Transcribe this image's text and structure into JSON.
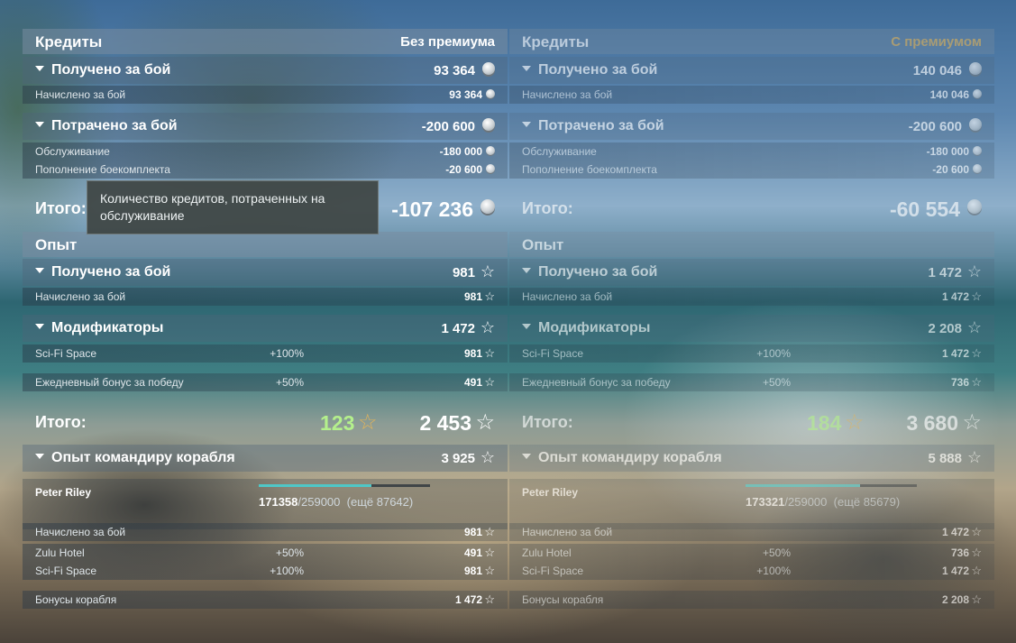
{
  "left": {
    "credits": {
      "header_title": "Кредиты",
      "header_right": "Без премиума",
      "earned": {
        "title": "Получено за бой",
        "value": "93 364",
        "items": [
          {
            "label": "Начислено за бой",
            "value": "93 364"
          }
        ]
      },
      "spent": {
        "title": "Потрачено за бой",
        "value": "-200 600",
        "items": [
          {
            "label": "Обслуживание",
            "value": "-180 000"
          },
          {
            "label": "Пополнение боекомплекта",
            "value": "-20 600"
          }
        ]
      },
      "total_label": "Итого:",
      "total_value": "-107 236"
    },
    "experience": {
      "header_title": "Опыт",
      "earned": {
        "title": "Получено за бой",
        "value": "981",
        "items": [
          {
            "label": "Начислено за бой",
            "value": "981"
          }
        ]
      },
      "modifiers": {
        "title": "Модификаторы",
        "value": "1 472",
        "items": [
          {
            "label": "Sci-Fi Space",
            "pct": "+100%",
            "value": "981"
          },
          {
            "label": "Ежедневный бонус за победу",
            "pct": "+50%",
            "value": "491"
          }
        ]
      },
      "total_label": "Итого:",
      "total_free": "123",
      "total_value": "2 453",
      "commander": {
        "title": "Опыт командиру корабля",
        "value": "3 925",
        "name": "Peter Riley",
        "progress_current": "171358",
        "progress_sep": "/",
        "progress_max": "259000",
        "progress_remaining": "(ещё 87642)",
        "progress_fraction": 0.66,
        "items": [
          {
            "label": "Начислено за бой",
            "pct": "",
            "value": "981"
          },
          {
            "label": "Zulu Hotel",
            "pct": "+50%",
            "value": "491"
          },
          {
            "label": "Sci-Fi Space",
            "pct": "+100%",
            "value": "981"
          },
          {
            "label": "Бонусы корабля",
            "pct": "",
            "value": "1 472"
          }
        ]
      }
    }
  },
  "right": {
    "credits": {
      "header_title": "Кредиты",
      "header_right": "С премиумом",
      "earned": {
        "title": "Получено за бой",
        "value": "140 046",
        "items": [
          {
            "label": "Начислено за бой",
            "value": "140 046"
          }
        ]
      },
      "spent": {
        "title": "Потрачено за бой",
        "value": "-200 600",
        "items": [
          {
            "label": "Обслуживание",
            "value": "-180 000"
          },
          {
            "label": "Пополнение боекомплекта",
            "value": "-20 600"
          }
        ]
      },
      "total_label": "Итого:",
      "total_value": "-60 554"
    },
    "experience": {
      "header_title": "Опыт",
      "earned": {
        "title": "Получено за бой",
        "value": "1 472",
        "items": [
          {
            "label": "Начислено за бой",
            "value": "1 472"
          }
        ]
      },
      "modifiers": {
        "title": "Модификаторы",
        "value": "2 208",
        "items": [
          {
            "label": "Sci-Fi Space",
            "pct": "+100%",
            "value": "1 472"
          },
          {
            "label": "Ежедневный бонус за победу",
            "pct": "+50%",
            "value": "736"
          }
        ]
      },
      "total_label": "Итого:",
      "total_free": "184",
      "total_value": "3 680",
      "commander": {
        "title": "Опыт командиру корабля",
        "value": "5 888",
        "name": "Peter Riley",
        "progress_current": "173321",
        "progress_sep": "/",
        "progress_max": "259000",
        "progress_remaining": "(ещё 85679)",
        "progress_fraction": 0.67,
        "items": [
          {
            "label": "Начислено за бой",
            "pct": "",
            "value": "1 472"
          },
          {
            "label": "Zulu Hotel",
            "pct": "+50%",
            "value": "736"
          },
          {
            "label": "Sci-Fi Space",
            "pct": "+100%",
            "value": "1 472"
          },
          {
            "label": "Бонусы корабля",
            "pct": "",
            "value": "2 208"
          }
        ]
      }
    }
  },
  "tooltip": {
    "text": "Количество кредитов, потраченных на обслуживание"
  },
  "colors": {
    "premium_gold": "#e3b45a",
    "free_xp_green": "#b4f08c",
    "progress_bar": "#4fc7c7"
  },
  "icons": {
    "credits": "coin-icon",
    "experience": "star-icon"
  }
}
